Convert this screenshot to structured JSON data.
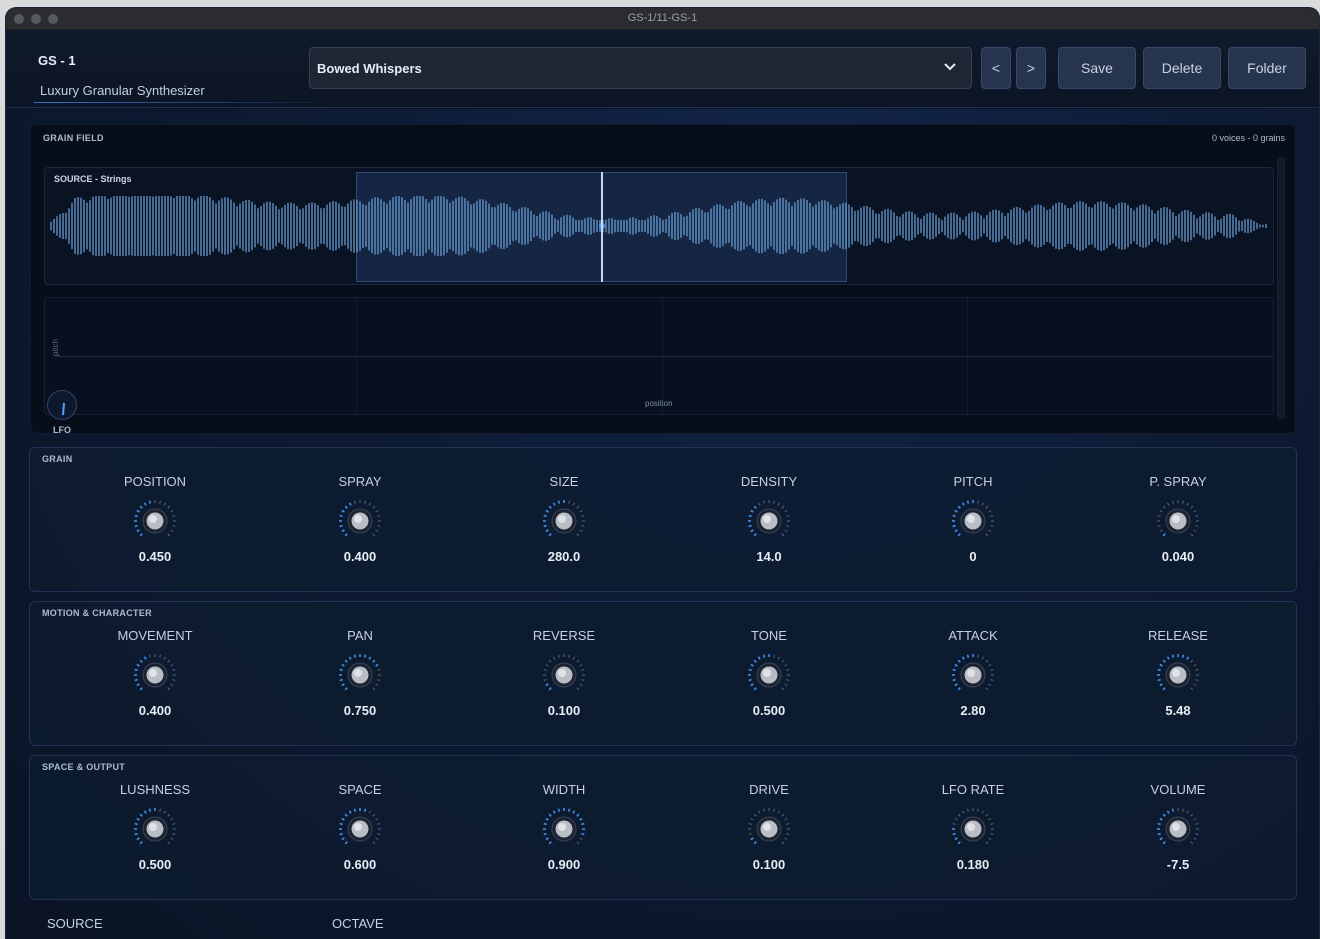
{
  "window": {
    "title": "GS-1/11-GS-1"
  },
  "header": {
    "brand_title": "GS - 1",
    "brand_subtitle": "Luxury Granular Synthesizer",
    "preset_name": "Bowed Whispers",
    "prev_label": "<",
    "next_label": ">",
    "save_label": "Save",
    "delete_label": "Delete",
    "folder_label": "Folder"
  },
  "grain_field": {
    "title": "GRAIN FIELD",
    "status": "0 voices - 0 grains",
    "source_label": "SOURCE - Strings",
    "pitch_axis": "pitch",
    "position_axis": "position",
    "lfo_label": "LFO"
  },
  "sections": [
    {
      "title": "GRAIN",
      "knobs": [
        {
          "label": "POSITION",
          "value": "0.450",
          "level": 0.45
        },
        {
          "label": "SPRAY",
          "value": "0.400",
          "level": 0.4
        },
        {
          "label": "SIZE",
          "value": "280.0",
          "level": 0.55
        },
        {
          "label": "DENSITY",
          "value": "14.0",
          "level": 0.35
        },
        {
          "label": "PITCH",
          "value": "0",
          "level": 0.5
        },
        {
          "label": "P. SPRAY",
          "value": "0.040",
          "level": 0.04
        }
      ]
    },
    {
      "title": "MOTION & CHARACTER",
      "knobs": [
        {
          "label": "MOVEMENT",
          "value": "0.400",
          "level": 0.4
        },
        {
          "label": "PAN",
          "value": "0.750",
          "level": 0.75
        },
        {
          "label": "REVERSE",
          "value": "0.100",
          "level": 0.1
        },
        {
          "label": "TONE",
          "value": "0.500",
          "level": 0.5
        },
        {
          "label": "ATTACK",
          "value": "2.80",
          "level": 0.55
        },
        {
          "label": "RELEASE",
          "value": "5.48",
          "level": 0.65
        }
      ]
    },
    {
      "title": "SPACE & OUTPUT",
      "knobs": [
        {
          "label": "LUSHNESS",
          "value": "0.500",
          "level": 0.5
        },
        {
          "label": "SPACE",
          "value": "0.600",
          "level": 0.6
        },
        {
          "label": "WIDTH",
          "value": "0.900",
          "level": 0.9
        },
        {
          "label": "DRIVE",
          "value": "0.100",
          "level": 0.1
        },
        {
          "label": "LFO RATE",
          "value": "0.180",
          "level": 0.18
        },
        {
          "label": "VOLUME",
          "value": "-7.5",
          "level": 0.45
        }
      ]
    }
  ],
  "bottom": {
    "source_label": "SOURCE",
    "octave_label": "OCTAVE"
  },
  "colors": {
    "accent": "#3f8ff0",
    "background": "#0b1220",
    "panel": "#0e1c30"
  }
}
